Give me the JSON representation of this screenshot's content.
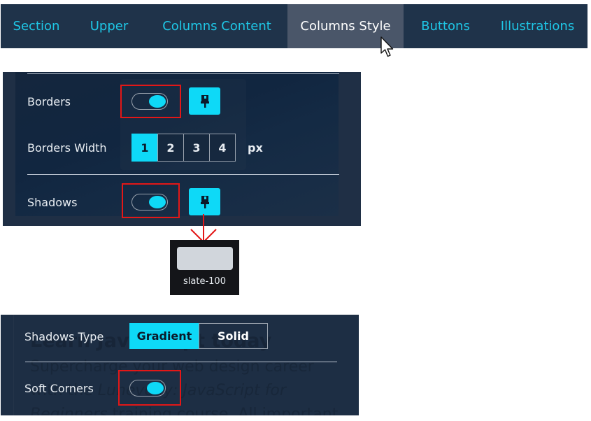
{
  "tabs": [
    {
      "label": "Section",
      "active": false
    },
    {
      "label": "Upper",
      "active": false
    },
    {
      "label": "Columns Content",
      "active": false
    },
    {
      "label": "Columns Style",
      "active": true
    },
    {
      "label": "Buttons",
      "active": false
    },
    {
      "label": "Illustrations",
      "active": false
    }
  ],
  "colors": {
    "accent": "#0ed9f7",
    "tab_text": "#1fc7e6",
    "panel_bg": "#1f2f45",
    "tabbar_bg": "#1f334a",
    "active_tab_bg": "#4a5669",
    "highlight_box": "#e31717"
  },
  "upper_panel": {
    "borders": {
      "label": "Borders",
      "toggle_on": true,
      "icon": "paint-brush-icon"
    },
    "borders_width": {
      "label": "Borders Width",
      "options": [
        "1",
        "2",
        "3",
        "4"
      ],
      "selected": "1",
      "unit": "px"
    },
    "shadows": {
      "label": "Shadows",
      "toggle_on": true,
      "icon": "paint-brush-icon"
    }
  },
  "swatch": {
    "color_name": "slate-100",
    "color": "#d1d6dc"
  },
  "lower_panel": {
    "shadows_type": {
      "label": "Shadows Type",
      "options": [
        "Gradient",
        "Solid"
      ],
      "selected": "Gradient"
    },
    "soft_corners": {
      "label": "Soft Corners",
      "toggle_on": true
    },
    "background_preview": {
      "heading": "Learn JavaScript today",
      "line1": "Supercharge your web design career",
      "line2_prefix": "with the ",
      "line2_italic": "Lunevedy: JavaScript for",
      "line3_italic": "Beginners",
      "line3_rest": " training course. All important"
    }
  }
}
